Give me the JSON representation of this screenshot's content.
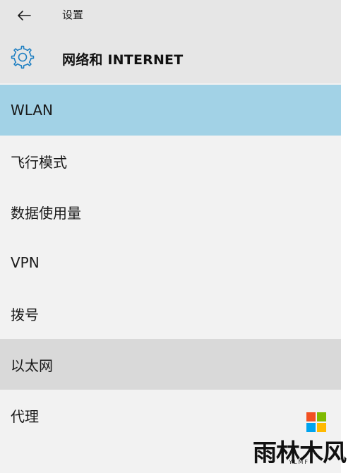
{
  "header": {
    "back_icon": "arrow-left-icon",
    "app_title": "设置",
    "section_icon": "gear-icon",
    "section_title": "网络和 INTERNET"
  },
  "nav": {
    "items": [
      {
        "label": "WLAN",
        "state": "selected"
      },
      {
        "label": "飞行模式",
        "state": "normal"
      },
      {
        "label": "数据使用量",
        "state": "normal"
      },
      {
        "label": "VPN",
        "state": "normal"
      },
      {
        "label": "拨号",
        "state": "normal"
      },
      {
        "label": "以太网",
        "state": "hover"
      },
      {
        "label": "代理",
        "state": "normal"
      }
    ]
  },
  "watermark": {
    "text": "雨林木风",
    "subtext": "YLMF",
    "logo_icon": "windows-logo-icon"
  },
  "colors": {
    "panel_bg": "#f2f2f2",
    "header_bg": "#e6e6e6",
    "selected_bg": "#a2d2e6",
    "hover_bg": "#d9d9d9",
    "accent": "#1e7fc2",
    "logo_red": "#f25022",
    "logo_green": "#7fba00",
    "logo_blue": "#00a4ef",
    "logo_yellow": "#ffb900"
  }
}
